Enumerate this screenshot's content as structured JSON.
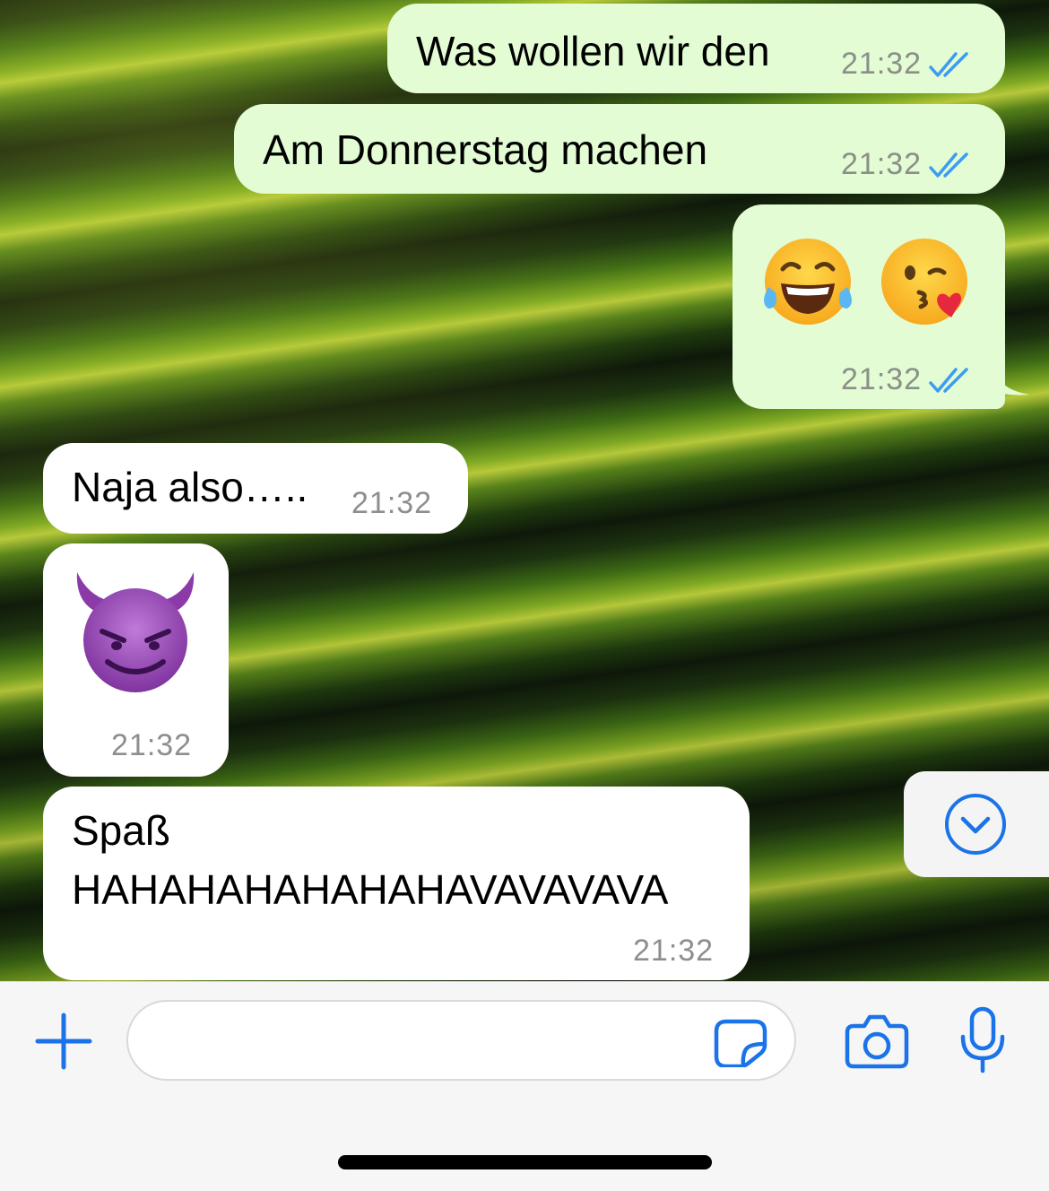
{
  "theme": {
    "outgoing_bubble": "#e3fcd4",
    "incoming_bubble": "#ffffff",
    "accent": "#1a73e8",
    "read_check": "#3b9cf2"
  },
  "messages": [
    {
      "direction": "outgoing",
      "text": "Was wollen wir den",
      "time": "21:32",
      "status": "read"
    },
    {
      "direction": "outgoing",
      "text": "Am Donnerstag machen",
      "time": "21:32",
      "status": "read"
    },
    {
      "direction": "outgoing",
      "emojis": [
        "face-with-tears-of-joy",
        "face-blowing-a-kiss"
      ],
      "time": "21:32",
      "status": "read"
    },
    {
      "direction": "incoming",
      "text": "Naja also…..",
      "time": "21:32"
    },
    {
      "direction": "incoming",
      "emojis": [
        "smiling-face-with-horns"
      ],
      "time": "21:32"
    },
    {
      "direction": "incoming",
      "text_line1": "Spaß",
      "text_line2": "HAHAHAHAHAHAHAVAVAVAVA",
      "time": "21:32"
    }
  ],
  "composer": {
    "placeholder": "",
    "value": ""
  },
  "icons": {
    "attach": "plus-icon",
    "sticker": "sticker-icon",
    "camera": "camera-icon",
    "mic": "microphone-icon",
    "scroll_down": "chevron-down-circle-icon"
  }
}
